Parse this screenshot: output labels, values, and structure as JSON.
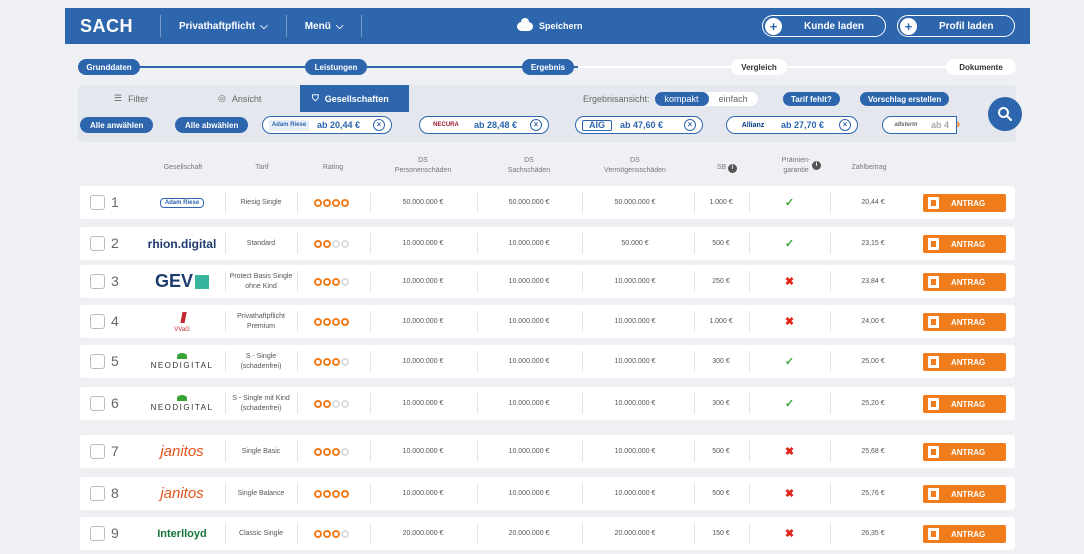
{
  "app": {
    "brand": "SACH",
    "nav1": "Privathaftpflicht",
    "nav2": "Menü",
    "save": "Speichern",
    "kunde": "Kunde laden",
    "profil": "Profil laden"
  },
  "steps": [
    "Grunddaten",
    "Leistungen",
    "Ergebnis",
    "Vergleich",
    "Dokumente"
  ],
  "tabs": {
    "filter": "Filter",
    "ansicht": "Ansicht",
    "gesellschaften": "Gesellschaften"
  },
  "ergebnis": {
    "label": "Ergebnisansicht:",
    "kompakt": "kompakt",
    "einfach": "einfach",
    "tarif_fehlt": "Tarif fehlt?",
    "vorschlag": "Vorschlag erstellen"
  },
  "select": {
    "all": "Alle anwählen",
    "none": "Alle abwählen"
  },
  "chips": [
    {
      "logo": "Adam Riese",
      "price": "ab 20,44 €"
    },
    {
      "logo": "NECURA",
      "price": "ab 28,48 €"
    },
    {
      "logo": "AIG",
      "price": "ab 47,60 €"
    },
    {
      "logo": "Allianz",
      "price": "ab 27,70 €"
    },
    {
      "logo": "allsterm",
      "price": "ab 4"
    }
  ],
  "columns": {
    "gesellschaft": "Gesellschaft",
    "tarif": "Tarif",
    "rating": "Rating",
    "ds1": "DS",
    "ds1b": "Personenschäden",
    "ds2": "DS",
    "ds2b": "Sachschäden",
    "ds3": "DS",
    "ds3b": "Vermögensschäden",
    "sb": "SB",
    "praemie": "Prämien-",
    "praemieb": "garantie",
    "zahl": "Zahlbeitrag"
  },
  "antrag_label": "ANTRAG",
  "rows": [
    {
      "num": "1",
      "logo": "Adam Riese",
      "tarif": "Riesig Single",
      "rating": 4,
      "p": "50.000.000 €",
      "s": "50.000.000 €",
      "v": "50.000.000 €",
      "sb": "1.000 €",
      "garantie": true,
      "beitrag": "20,44 €"
    },
    {
      "num": "2",
      "logo": "rhion.digital",
      "tarif": "Standard",
      "rating": 2,
      "p": "10.000.000 €",
      "s": "10.000.000 €",
      "v": "50.000 €",
      "sb": "500 €",
      "garantie": true,
      "beitrag": "23,15 €"
    },
    {
      "num": "3",
      "logo": "GEV",
      "tarif": "Protect Basis Single ohne Kind",
      "rating": 3,
      "p": "10.000.000 €",
      "s": "10.000.000 €",
      "v": "10.000.000 €",
      "sb": "250 €",
      "garantie": false,
      "beitrag": "23,84 €"
    },
    {
      "num": "4",
      "logo": "VVaG",
      "tarif": "Privathaftpflicht Premium",
      "rating": 4,
      "p": "10.000.000 €",
      "s": "10.000.000 €",
      "v": "10.000.000 €",
      "sb": "1.000 €",
      "garantie": false,
      "beitrag": "24,00 €"
    },
    {
      "num": "5",
      "logo": "NEODIGITAL",
      "tarif": "S - Single (schadenfrei)",
      "rating": 3,
      "p": "10.000.000 €",
      "s": "10.000.000 €",
      "v": "10.000.000 €",
      "sb": "300 €",
      "garantie": true,
      "beitrag": "25,00 €"
    },
    {
      "num": "6",
      "logo": "NEODIGITAL",
      "tarif": "S - Single mit Kind (schadenfrei)",
      "rating": 2,
      "p": "10.000.000 €",
      "s": "10.000.000 €",
      "v": "10.000.000 €",
      "sb": "300 €",
      "garantie": true,
      "beitrag": "25,20 €"
    },
    {
      "num": "7",
      "logo": "janitos",
      "tarif": "Single Basic",
      "rating": 3,
      "p": "10.000.000 €",
      "s": "10.000.000 €",
      "v": "10.000.000 €",
      "sb": "500 €",
      "garantie": false,
      "beitrag": "25,68 €"
    },
    {
      "num": "8",
      "logo": "janitos",
      "tarif": "Single Balance",
      "rating": 4,
      "p": "10.000.000 €",
      "s": "10.000.000 €",
      "v": "10.000.000 €",
      "sb": "500 €",
      "garantie": false,
      "beitrag": "25,76 €"
    },
    {
      "num": "9",
      "logo": "Interlloyd",
      "tarif": "Classic Single",
      "rating": 3,
      "p": "20.000.000 €",
      "s": "20.000.000 €",
      "v": "20.000.000 €",
      "sb": "150 €",
      "garantie": false,
      "beitrag": "26,35 €"
    }
  ],
  "colors": {
    "brand": "#2d66ad",
    "accent": "#f07c1c",
    "ok": "#3aa335",
    "no": "#e0261b"
  }
}
